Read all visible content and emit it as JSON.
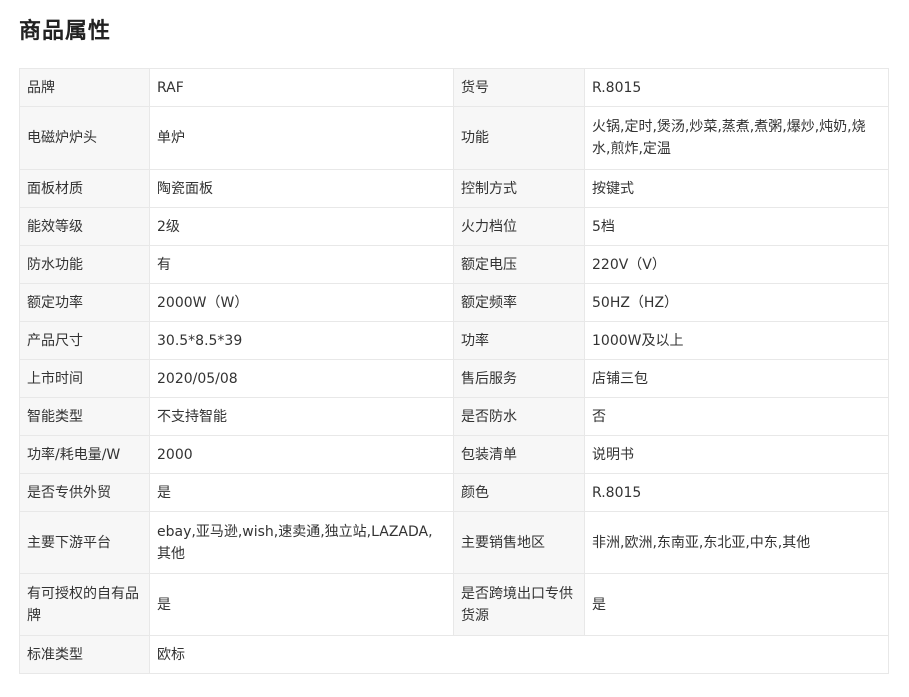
{
  "page": {
    "title": "商品属性"
  },
  "attributes": [
    {
      "label": "品牌",
      "value": "RAF"
    },
    {
      "label": "货号",
      "value": "R.8015"
    },
    {
      "label": "电磁炉炉头",
      "value": "单炉"
    },
    {
      "label": "功能",
      "value": "火锅,定时,煲汤,炒菜,蒸煮,煮粥,爆炒,炖奶,烧水,煎炸,定温"
    },
    {
      "label": "面板材质",
      "value": "陶瓷面板"
    },
    {
      "label": "控制方式",
      "value": "按键式"
    },
    {
      "label": "能效等级",
      "value": "2级"
    },
    {
      "label": "火力档位",
      "value": "5档"
    },
    {
      "label": "防水功能",
      "value": "有"
    },
    {
      "label": "额定电压",
      "value": "220V（V）"
    },
    {
      "label": "额定功率",
      "value": "2000W（W）"
    },
    {
      "label": "额定频率",
      "value": "50HZ（HZ）"
    },
    {
      "label": "产品尺寸",
      "value": "30.5*8.5*39"
    },
    {
      "label": "功率",
      "value": "1000W及以上"
    },
    {
      "label": "上市时间",
      "value": "2020/05/08"
    },
    {
      "label": "售后服务",
      "value": "店铺三包"
    },
    {
      "label": "智能类型",
      "value": "不支持智能"
    },
    {
      "label": "是否防水",
      "value": "否"
    },
    {
      "label": "功率/耗电量/W",
      "value": "2000"
    },
    {
      "label": "包装清单",
      "value": "说明书"
    },
    {
      "label": "是否专供外贸",
      "value": "是"
    },
    {
      "label": "颜色",
      "value": "R.8015"
    },
    {
      "label": "主要下游平台",
      "value": "ebay,亚马逊,wish,速卖通,独立站,LAZADA,其他"
    },
    {
      "label": "主要销售地区",
      "value": "非洲,欧洲,东南亚,东北亚,中东,其他"
    },
    {
      "label": "有可授权的自有品牌",
      "value": "是"
    },
    {
      "label": "是否跨境出口专供货源",
      "value": "是"
    },
    {
      "label": "标准类型",
      "value": "欧标"
    }
  ]
}
